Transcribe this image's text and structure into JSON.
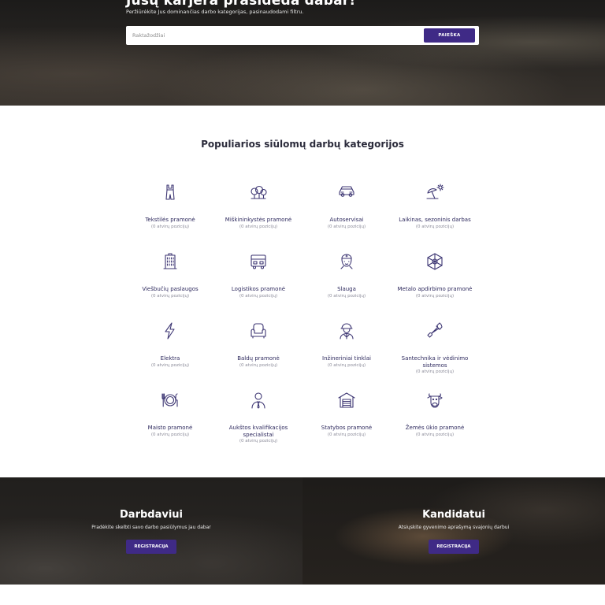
{
  "hero": {
    "title": "Jūsų karjera prasideda dabar!",
    "subtitle": "Peržiūrėkite Jus dominančias darbo kategorijas, pasinaudodami filtru.",
    "search_placeholder": "Raktažodžiai",
    "search_button": "PAIEŠKA"
  },
  "categories_title": "Populiarios siūlomų darbų kategorijos",
  "categories": [
    {
      "name": "Tekstilės pramonė",
      "count": "(0 atvirų pozicijų)",
      "icon": "overalls-icon"
    },
    {
      "name": "Miškininkystės pramonė",
      "count": "(0 atvirų pozicijų)",
      "icon": "trees-icon"
    },
    {
      "name": "Autoservisai",
      "count": "(0 atvirų pozicijų)",
      "icon": "car-icon"
    },
    {
      "name": "Laikinas, sezoninis darbas",
      "count": "(0 atvirų pozicijų)",
      "icon": "beach-umbrella-icon"
    },
    {
      "name": "Viešbučių paslaugos",
      "count": "(0 atvirų pozicijų)",
      "icon": "hotel-building-icon"
    },
    {
      "name": "Logistikos pramonė",
      "count": "(0 atvirų pozicijų)",
      "icon": "truck-icon"
    },
    {
      "name": "Slauga",
      "count": "(0 atvirų pozicijų)",
      "icon": "nurse-icon"
    },
    {
      "name": "Metalo apdirbimo pramonė",
      "count": "(0 atvirų pozicijų)",
      "icon": "hex-nut-icon"
    },
    {
      "name": "Elektra",
      "count": "(0 atvirų pozicijų)",
      "icon": "lightning-icon"
    },
    {
      "name": "Baldų pramonė",
      "count": "(0 atvirų pozicijų)",
      "icon": "armchair-icon"
    },
    {
      "name": "Inžineriniai tinklai",
      "count": "(0 atvirų pozicijų)",
      "icon": "engineer-icon"
    },
    {
      "name": "Santechnika ir vėdinimo sistemos",
      "count": "(0 atvirų pozicijų)",
      "icon": "wrench-icon"
    },
    {
      "name": "Maisto pramonė",
      "count": "(0 atvirų pozicijų)",
      "icon": "plate-cutlery-icon"
    },
    {
      "name": "Aukštos kvalifikacijos specialistai",
      "count": "(0 atvirų pozicijų)",
      "icon": "businessman-icon"
    },
    {
      "name": "Statybos pramonė",
      "count": "(0 atvirų pozicijų)",
      "icon": "garage-icon"
    },
    {
      "name": "Žemės ūkio pramonė",
      "count": "(0 atvirų pozicijų)",
      "icon": "cow-icon"
    }
  ],
  "employer": {
    "title": "Darbdaviui",
    "text": "Pradėkite skelbti savo darbo pasiūlymus jau dabar",
    "button": "REGISTRACIJA"
  },
  "candidate": {
    "title": "Kandidatui",
    "text": "Atsiųskite gyvenimo aprašymą svajonių darbui",
    "button": "REGISTRACIJA"
  },
  "colors": {
    "accent": "#3f2a86",
    "icon_stroke": "#3d3673",
    "category_text": "#2e2a5e"
  }
}
